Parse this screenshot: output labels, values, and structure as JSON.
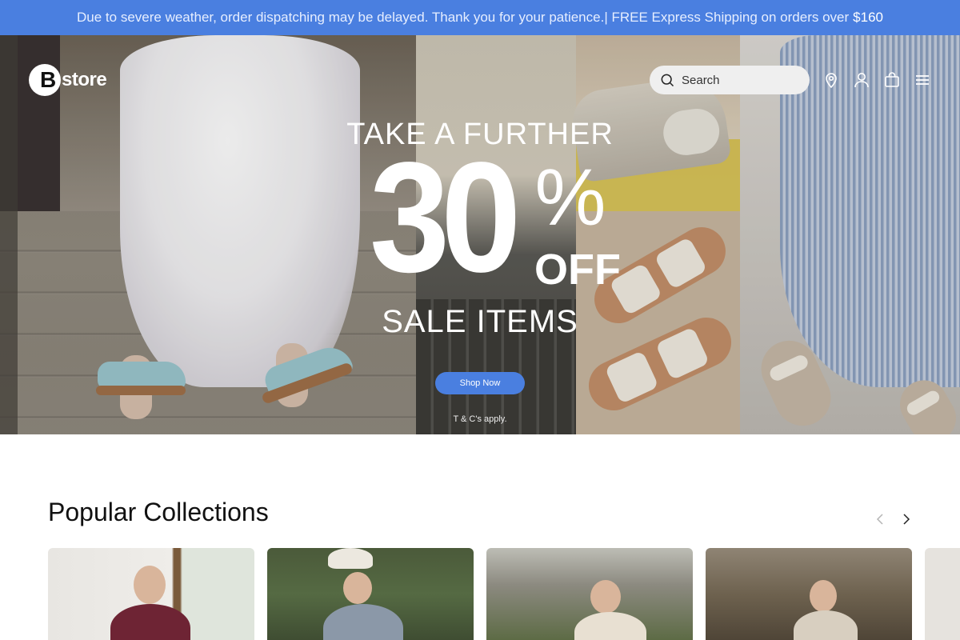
{
  "announcement": {
    "text": "Due to severe weather, order dispatching may be delayed. Thank you for your patience.| FREE Express Shipping on orders over",
    "amount": "$160"
  },
  "header": {
    "logo_mark": "B",
    "logo_text": "store",
    "search_placeholder": "Search",
    "icons": [
      "location-pin-icon",
      "user-icon",
      "shopping-bag-icon",
      "menu-icon"
    ]
  },
  "hero": {
    "line1": "TAKE A FURTHER",
    "big": "30",
    "percent": "%",
    "off": "OFF",
    "sale": "SALE ITEMS",
    "cta": "Shop Now",
    "terms": "T & C's apply."
  },
  "collections": {
    "title": "Popular Collections",
    "prev_icon": "chevron-left-icon",
    "next_icon": "chevron-right-icon"
  },
  "colors": {
    "accent": "#4a7fe0",
    "text": "#111111",
    "white": "#ffffff"
  }
}
